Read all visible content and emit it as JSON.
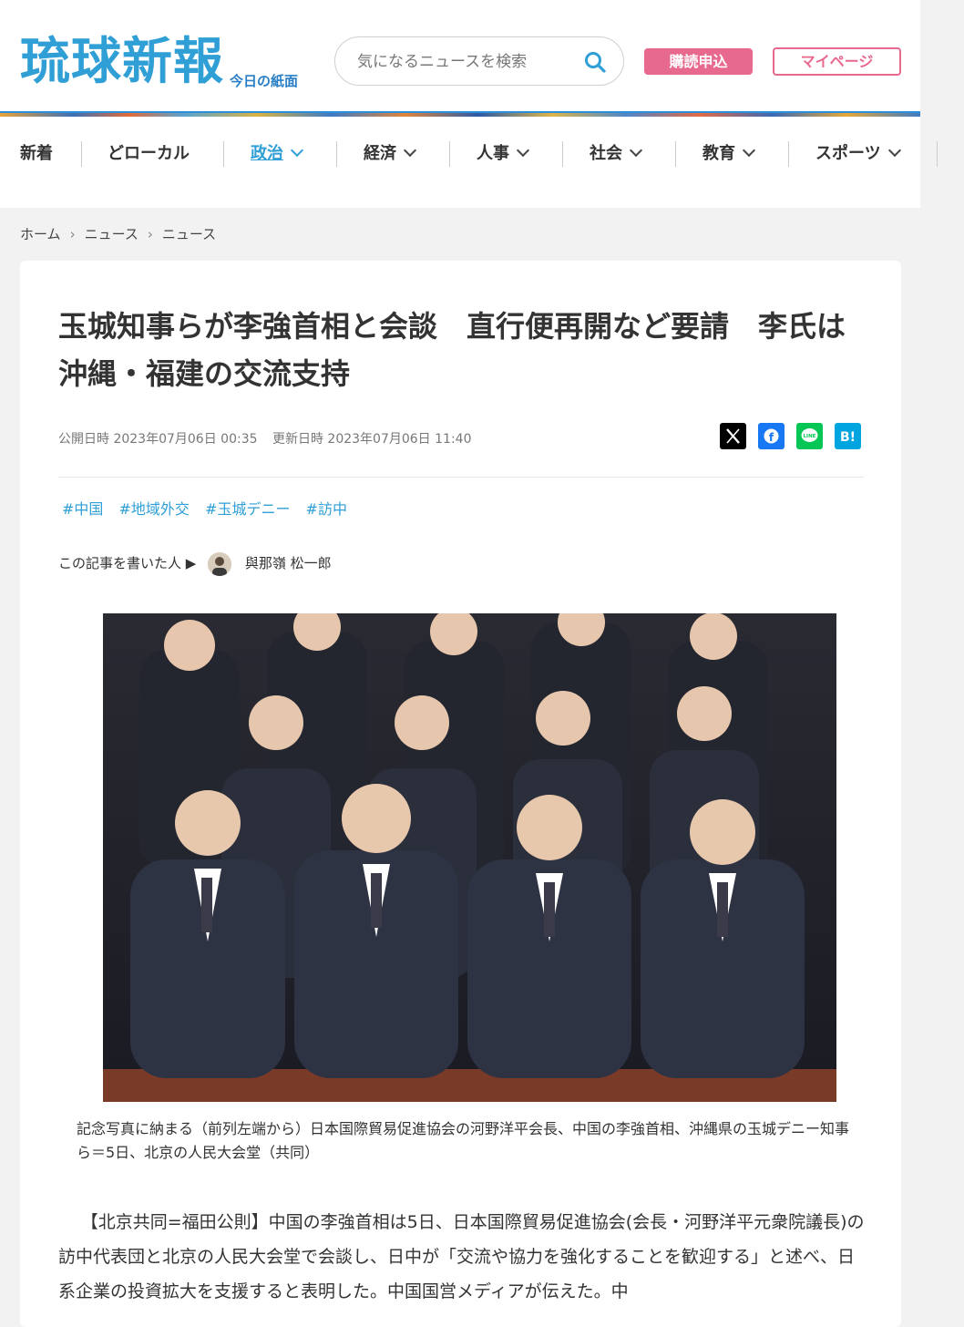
{
  "site": {
    "logo_text": "琉球新報",
    "logo_sub": "今日の紙面",
    "search_placeholder": "気になるニュースを検索",
    "subscribe_label": "購読申込",
    "mypage_label": "マイページ"
  },
  "nav": {
    "items": [
      {
        "label": "新着"
      },
      {
        "label": "どローカル"
      },
      {
        "label": "政治"
      },
      {
        "label": "経済"
      },
      {
        "label": "人事"
      },
      {
        "label": "社会"
      },
      {
        "label": "教育"
      },
      {
        "label": "スポーツ"
      }
    ],
    "active": "政治"
  },
  "breadcrumb": [
    "ホーム",
    "ニュース",
    "ニュース"
  ],
  "article": {
    "title": "玉城知事らが李強首相と会談　直行便再開など要請　李氏は沖縄・福建の交流支持",
    "published_label": "公開日時",
    "published": "2023年07月06日 00:35",
    "updated_label": "更新日時",
    "updated": "2023年07月06日 11:40",
    "tags": [
      "#中国",
      "#地域外交",
      "#玉城デニー",
      "#訪中"
    ],
    "author_label": "この記事を書いた人 ▶",
    "author": "與那嶺 松一郎",
    "caption": "記念写真に納まる（前列左端から）日本国際貿易促進協会の河野洋平会長、中国の李強首相、沖縄県の玉城デニー知事ら＝5日、北京の人民大会堂（共同）",
    "body": "【北京共同=福田公則】中国の李強首相は5日、日本国際貿易促進協会(会長・河野洋平元衆院議長)の訪中代表団と北京の人民大会堂で会談し、日中が「交流や協力を強化することを歓迎する」と述べ、日系企業の投資拡大を支援すると表明した。中国国営メディアが伝えた。中"
  },
  "social": [
    {
      "name": "x",
      "glyph": "𝕏",
      "color": "#000000"
    },
    {
      "name": "facebook",
      "glyph": "f",
      "color": "#1877f2"
    },
    {
      "name": "line",
      "glyph": "LINE",
      "color": "#06c755"
    },
    {
      "name": "hatena",
      "glyph": "B!",
      "color": "#00a4de"
    }
  ],
  "colors": {
    "brand_blue": "#2f9fd6",
    "accent_pink": "#e8698e"
  }
}
